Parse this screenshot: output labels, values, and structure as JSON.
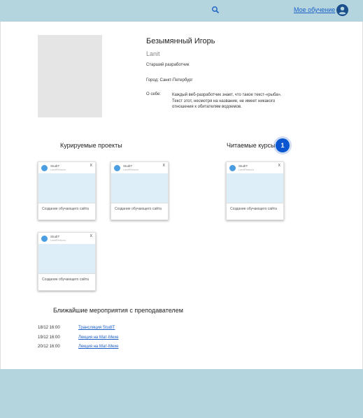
{
  "header": {
    "search_icon": "search-icon",
    "link_label": "Мое обучение",
    "user_icon": "account-circle-icon",
    "colors": {
      "bar": "#b5d5de",
      "link": "#1a5ec8"
    }
  },
  "profile": {
    "name": "Безымянный Игорь",
    "company": "Lanit",
    "position": "Старший разработчик",
    "city": "Город: Санкт-Петербург",
    "about_label": "О себе:",
    "about_text": "Каждый веб-разработчик знает, что такое текст-«рыба». Текст этот, несмотря на название, не имеет никакого отношения к обитателям водоемов."
  },
  "sections": {
    "supervised_title": "Курируемые проекты",
    "read_courses_title": "Читаемые курсы",
    "badge_count": "1",
    "events_title": "Ближайшие мероприятия с преподавателем"
  },
  "supervised_cards": [
    {
      "title": "StudIT",
      "sub": "LanitTerkom",
      "close": "X",
      "footer": "Создание обучающего сайта"
    },
    {
      "title": "StudIT",
      "sub": "LanitTerkom",
      "close": "X",
      "footer": "Создание обучающего сайта"
    },
    {
      "title": "StudIT",
      "sub": "LanitTerkom",
      "close": "X",
      "footer": "Создание обучающего сайта"
    }
  ],
  "course_cards": [
    {
      "title": "StudIT",
      "sub": "LanitTerkom",
      "close": "X",
      "footer": "Создание обучающего сайта"
    }
  ],
  "events": [
    {
      "date": "18/12 16:00",
      "title": "Трансляция StudIT"
    },
    {
      "date": "19/12 16:00",
      "title": "Лекция на Мат-Мехе"
    },
    {
      "date": "20/12 16:00",
      "title": "Лекция на Мат-Мехе"
    }
  ]
}
